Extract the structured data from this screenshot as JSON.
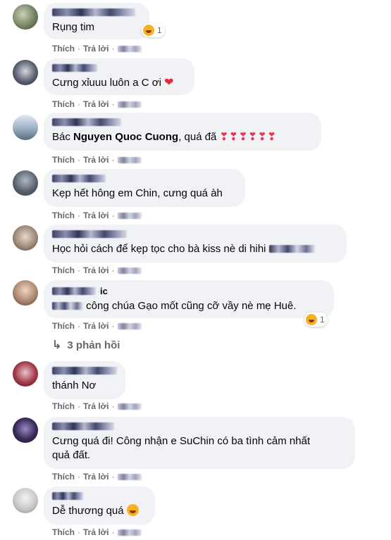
{
  "actions": {
    "like": "Thích",
    "reply": "Trả lời",
    "separator": "·"
  },
  "comments": [
    {
      "text": "Rụng tim",
      "reaction_count": "1",
      "avatar_color": "#7a8a6a"
    },
    {
      "text": "Cưng xỉuuu luôn a C ơi",
      "avatar_color": "#3a3f4a"
    },
    {
      "text_prefix": "Bác ",
      "mention": "Nguyen Quoc Cuong",
      "text_suffix": ", quá đã",
      "avatar_color": "#9fb4c9"
    },
    {
      "text": "Kẹp hết hông em Chin, cưng quá àh",
      "avatar_color": "#5a6470"
    },
    {
      "text": "Học hỏi cách để kẹp tọc cho bà kiss nè di hihi",
      "avatar_color": "#a08a7a"
    },
    {
      "name_fragment": "ic",
      "text": "công chúa Gạo mốt cũng cỡ vầy nè mẹ Huê.",
      "reaction_count": "1",
      "avatar_color": "#8a6a5a"
    },
    {
      "text": "thánh Nơ",
      "avatar_color": "#7a1a2a"
    },
    {
      "text_line1": "Cưng quá đi! Công nhận e SuChin có ba tình cảm nhất",
      "text_line2": "quả đất.",
      "avatar_color": "#3a2a5a"
    },
    {
      "text": "Dễ thương quá",
      "avatar_color": "#c9c9c9"
    }
  ],
  "replies": {
    "label": "3 phản hồi"
  }
}
